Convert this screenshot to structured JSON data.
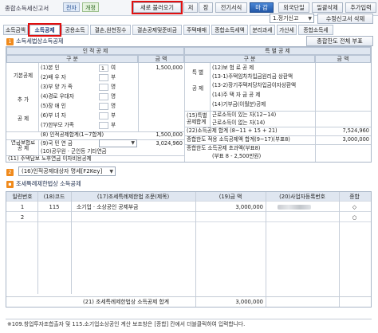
{
  "titlebar": {
    "app_title": "종합소득세신고서",
    "badge_e": "전자",
    "badge_p": "개정",
    "buttons": [
      "새로 불러오기",
      "저",
      "장",
      "전기서식",
      "마 감",
      "외국단일",
      "일괄삭제",
      "추가입력"
    ]
  },
  "tabs": [
    "소득금액",
    "소득공제",
    "공용소득",
    "결손,원천징수",
    "결손공제및준비금",
    "주택매매",
    "종합소득세액",
    "분리과세",
    "가산세",
    "종합소득세"
  ],
  "filing_select": "1.정기신고",
  "revise_button": "수정신고서 삭제",
  "section1": {
    "num": "1",
    "title": "소득세법상소득공제",
    "detail_button": "종합한도 전체 부표",
    "header_left": "인      적      공      제",
    "header_right": "특      별      공      제",
    "sub_gubun": "구        분",
    "sub_amount": "금        액",
    "rows_left": [
      {
        "group": "기본공제",
        "label": "(1)본        인",
        "count": "1",
        "unit": "여",
        "amount": "1,500,000"
      },
      {
        "group": "",
        "label": "(2)배  우  자",
        "count": "",
        "unit": "부",
        "amount": ""
      },
      {
        "group": "",
        "label": "(3)부 양 가 족",
        "count": "",
        "unit": "명",
        "amount": ""
      },
      {
        "group": "추  가",
        "label": "(4)경로 우대자",
        "count": "",
        "unit": "명",
        "amount": ""
      },
      {
        "group": "",
        "label": "(5)장  애  인",
        "count": "",
        "unit": "명",
        "amount": ""
      },
      {
        "group": "공  제",
        "label": "(6)부  녀  자",
        "count": "",
        "unit": "부",
        "amount": ""
      },
      {
        "group": "",
        "label": "(7)한부모 가족",
        "count": "",
        "unit": "부",
        "amount": ""
      }
    ],
    "personal_total_label": "(8) 인적공제합계(1~7합계)",
    "personal_total": "1,500,000",
    "pension_group": "연금보험료\n공  제",
    "pension_row1": "(9)국 민 연 금",
    "pension_row1_amount": "3,024,960",
    "pension_row2": "(10)공무원 · 군인등 기타연금",
    "housing_group": "(11) 주택담보 노후연금 이자비용공제",
    "rows_right": [
      {
        "group": "특  별",
        "label": "(12)보 험 료 공 제"
      },
      {
        "group": "",
        "label": "(13-1)주택임차차입금원리금 상환액"
      },
      {
        "group": "공  제",
        "label": "(13-2)장기주택저당차입금이자상환액"
      },
      {
        "group": "",
        "label": "(14)주 택 자 금 공 제"
      },
      {
        "group": "",
        "label": "(14)기부금(이월분)공제"
      }
    ],
    "special_total_group": "(15)특별\n공제합계",
    "special_total_a": "근로소득이 있는 자(12~14)",
    "special_total_b": "근로소득이 없는 자(14)",
    "deduction_total_label": "(22)소득공제 합계 (8~11 + 15 + 21)",
    "deduction_total": "7,524,960",
    "limit_label": "종합한도 적용 소득공제액 합계(9~17)(부표8)",
    "limit_amount": "3,000,000",
    "limit_over_label": "종합한도 소득공제 초과액(부표8)",
    "limit_note": "(부표 8 - 2,500만원)"
  },
  "section2": {
    "num": "2",
    "select": "(16)인적공제대상자 명세[F2Key]"
  },
  "section3": {
    "title": "조세특례제한법상 소득공제",
    "headers": [
      "일련번호",
      "(18)코드",
      "(17)조세특례제한법 조문(제목)",
      "(19)금          액",
      "(20)사업자등록번호",
      "종합"
    ],
    "rows": [
      {
        "no": "1",
        "code": "115",
        "title": "소기업 · 소상공인 공제부금",
        "amount": "3,000,000",
        "regno": "",
        "mark": "◇"
      },
      {
        "no": "2",
        "code": "",
        "title": "",
        "amount": "",
        "regno": "",
        "mark": "○"
      }
    ],
    "total_label": "(21) 조세특례제한법상 소득공제 합계",
    "total_amount": "3,000,000"
  },
  "footer_note": "※109.창업투자조합출자 및 115.소기업소상공인 계산 보조창은 [종합] 칸에서 더블클릭하여 입력합니다."
}
